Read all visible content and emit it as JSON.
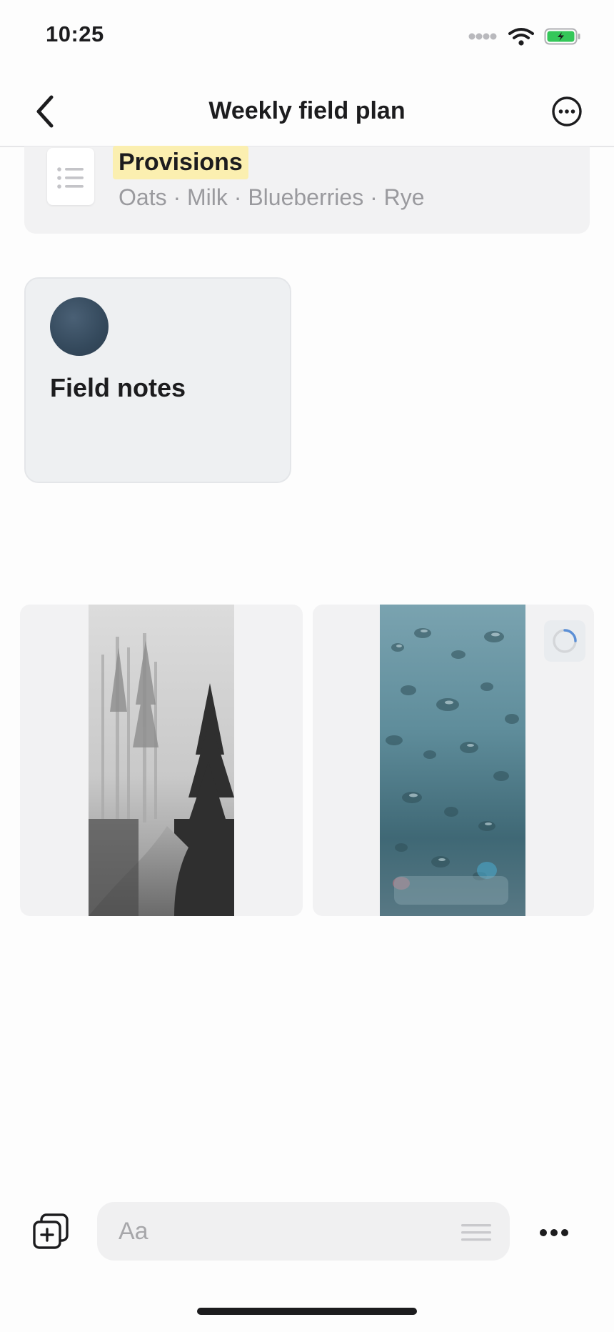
{
  "status_bar": {
    "time": "10:25",
    "icons": [
      "signal-icon",
      "wifi-icon",
      "battery-charging-icon"
    ],
    "battery_color": "#34c759"
  },
  "nav": {
    "title": "Weekly field plan",
    "back_icon": "chevron-left-icon",
    "more_icon": "ellipsis-circle-icon"
  },
  "provisions": {
    "title": "Provisions",
    "items": "Oats · Milk · Blueberries · Rye",
    "icon": "list-icon",
    "highlight_color": "#fbefb0"
  },
  "field_notes": {
    "title": "Field notes",
    "avatar_color": "#3b5063"
  },
  "media": {
    "tiles": [
      {
        "name": "foggy-forest-photo"
      },
      {
        "name": "raindrops-window-photo",
        "loading": true
      }
    ]
  },
  "composer": {
    "placeholder": "Aa",
    "add_icon": "add-block-icon",
    "format_icon": "text-format-icon",
    "more_icon": "more-dots-icon"
  }
}
